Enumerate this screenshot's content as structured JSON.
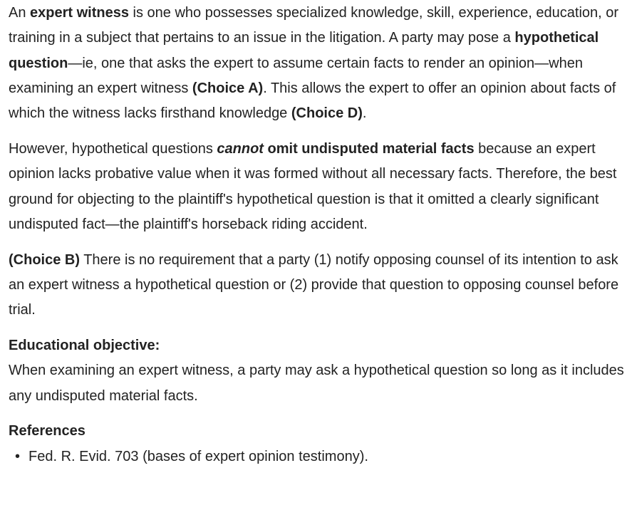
{
  "para1": {
    "t1": "An ",
    "b1": "expert witness",
    "t2": " is one who possesses specialized knowledge, skill, experience, education, or training in a subject that pertains to an issue in the litigation.  A party may pose a ",
    "b2": "hypothetical question",
    "t3": "—ie, one that asks the expert to assume certain facts to render an opinion—when examining an expert witness ",
    "b3": "(Choice A)",
    "t4": ".  This allows the expert to offer an opinion about facts of which the witness lacks firsthand knowledge ",
    "b4": "(Choice D)",
    "t5": "."
  },
  "para2": {
    "t1": "However, hypothetical questions ",
    "bi1": "cannot",
    "b1": " omit undisputed material facts",
    "t2": " because an expert opinion lacks probative value when it was formed without all necessary facts.  Therefore, the best ground for objecting to the plaintiff's hypothetical question is that it omitted a clearly significant undisputed fact—the plaintiff's horseback riding accident."
  },
  "para3": {
    "b1": "(Choice B)",
    "t1": "  There is no requirement that a party (1) notify opposing counsel of its intention to ask an expert witness a hypothetical question or (2) provide that question to opposing counsel before trial."
  },
  "objective": {
    "heading": "Educational objective:",
    "text": "When examining an expert witness, a party may ask a hypothetical question so long as it includes any undisputed material facts."
  },
  "references": {
    "heading": "References",
    "bullet": "•",
    "items": [
      "Fed. R. Evid. 703 (bases of expert opinion testimony)."
    ]
  }
}
